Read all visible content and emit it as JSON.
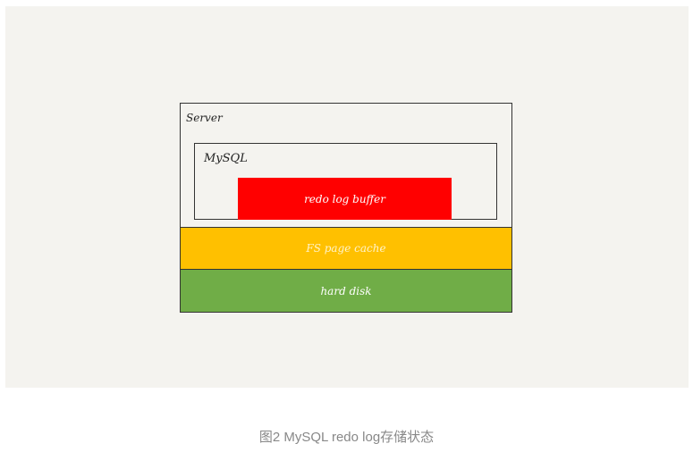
{
  "diagram": {
    "server_label": "Server",
    "mysql_label": "MySQL",
    "buffer_label": "redo log buffer",
    "fs_cache_label": "FS page cache",
    "disk_label": "hard disk",
    "colors": {
      "buffer": "#ff0000",
      "fs_cache": "#ffc000",
      "disk": "#70ad47",
      "background": "#f4f3ef"
    }
  },
  "caption": "图2 MySQL redo log存储状态"
}
